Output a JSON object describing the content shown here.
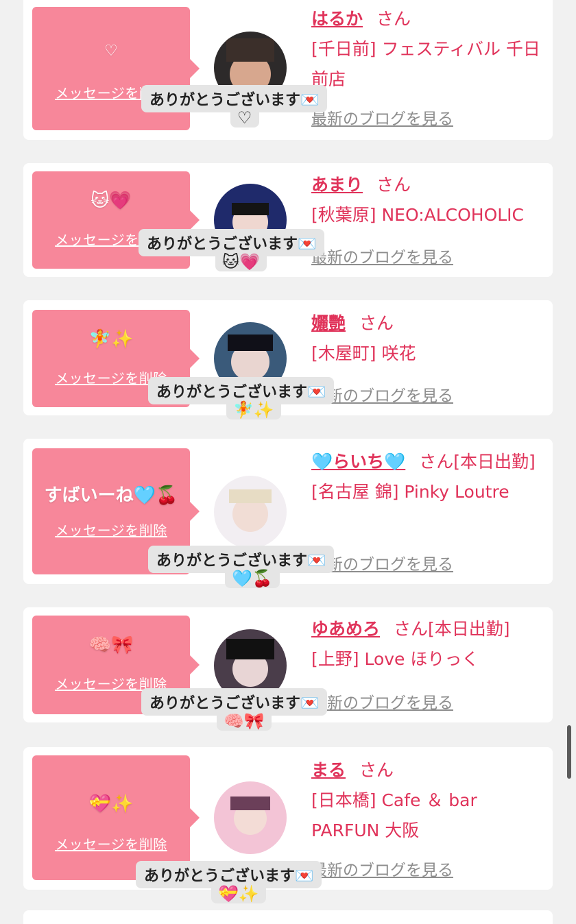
{
  "delete_label": "メッセージを削除",
  "blog_label": "最新のブログを見る",
  "tooltip_text": "ありがとうございます💌",
  "san": "さん",
  "colors": {
    "bubble": "#f7879a",
    "name": "#e0335a"
  },
  "entries": [
    {
      "message": "♡",
      "name": "はるか",
      "status": "",
      "shop": "[千日前] フェスティバル 千日前店",
      "tooltip_emoji": "♡"
    },
    {
      "message": "🐱💗",
      "name": "あまり",
      "status": "",
      "shop": "[秋葉原] NEO:ALCOHOLIC",
      "tooltip_emoji": "🐱💗"
    },
    {
      "message": "🧚✨",
      "name": "孋艷",
      "status": "",
      "shop": "[木屋町] 咲花",
      "tooltip_emoji": "🧚✨"
    },
    {
      "message": "すばいーね🩵🍒",
      "name": "🩵らいち🩵",
      "status": "[本日出勤]",
      "shop": "[名古屋 錦] Pinky Loutre",
      "tooltip_emoji": "🩵🍒"
    },
    {
      "message": "🧠🎀",
      "name": "ゆあめろ",
      "status": "[本日出勤]",
      "shop": "[上野] Love ほりっく",
      "tooltip_emoji": "🧠🎀"
    },
    {
      "message": "💝✨",
      "name": "まる",
      "status": "",
      "shop": "[日本橋] Cafe ＆ bar PARFUN 大阪",
      "tooltip_emoji": "💝✨"
    }
  ]
}
